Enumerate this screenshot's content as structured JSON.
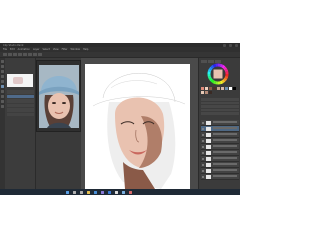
{
  "window": {
    "title": "Clip Studio Paint"
  },
  "menu": [
    "File",
    "Edit",
    "Animation",
    "Layer",
    "Select",
    "View",
    "Filter",
    "Window",
    "Help"
  ],
  "subtool": {
    "header": "Sub Tool",
    "selected_index": 1,
    "row_count": 6
  },
  "reference": {
    "label": "Reference"
  },
  "canvas": {
    "subject": "portrait sketch of a girl in a bucket hat"
  },
  "color": {
    "accent": "#4e6884",
    "skin_main": "#e9c2b0",
    "skin_shadow": "#b07e69",
    "hair": "#5a4037",
    "hat_blue": "#8fb4cf",
    "swatches": [
      "#e08a7a",
      "#f2d0c0",
      "#8a5a48",
      "#4a3028",
      "#c7a08a",
      "#d9b8a8",
      "#6c8fb0",
      "#ffffff",
      "#000000",
      "#e7c9b6",
      "#b58b78",
      "#3a2a24"
    ]
  },
  "layers": {
    "selected_index": 1,
    "count": 10
  },
  "taskbar": {
    "app_icons": [
      "start-icon",
      "search-icon",
      "taskview-icon",
      "explorer-icon",
      "browser-icon",
      "store-icon",
      "mail-icon",
      "clipstudio-icon",
      "photos-icon",
      "music-icon"
    ],
    "icon_colors": [
      "#5aa0e6",
      "#b0b0b0",
      "#b0b0b0",
      "#e6c050",
      "#4a90d9",
      "#8a7ad9",
      "#3a7ad9",
      "#e0e0e0",
      "#7ab0e0",
      "#d96a6a"
    ],
    "time": "",
    "date": ""
  }
}
